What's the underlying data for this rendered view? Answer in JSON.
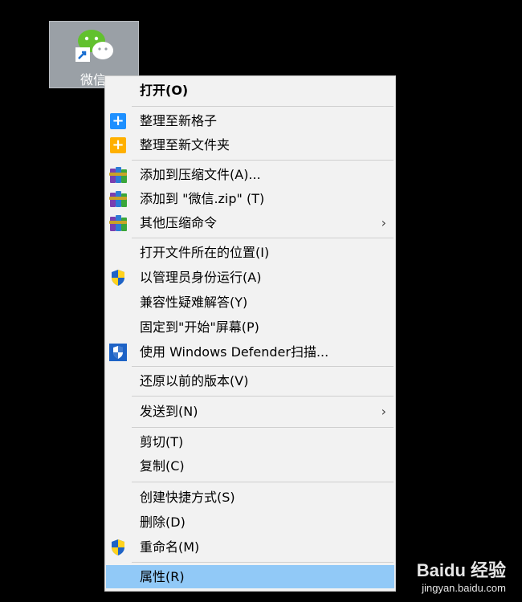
{
  "desktop": {
    "shortcut_label": "微信"
  },
  "menu": {
    "open": "打开(O)",
    "organize_new_box": "整理至新格子",
    "organize_new_folder": "整理至新文件夹",
    "add_to_archive": "添加到压缩文件(A)...",
    "add_to_zip": "添加到 \"微信.zip\" (T)",
    "other_compress": "其他压缩命令",
    "open_file_location": "打开文件所在的位置(I)",
    "run_as_admin": "以管理员身份运行(A)",
    "troubleshoot_compat": "兼容性疑难解答(Y)",
    "pin_to_start": "固定到\"开始\"屏幕(P)",
    "defender_scan": "使用 Windows Defender扫描...",
    "restore_previous": "还原以前的版本(V)",
    "send_to": "发送到(N)",
    "cut": "剪切(T)",
    "copy": "复制(C)",
    "create_shortcut": "创建快捷方式(S)",
    "delete": "删除(D)",
    "rename": "重命名(M)",
    "properties": "属性(R)",
    "submenu_arrow": "›"
  },
  "watermark": {
    "title": "Baidu 经验",
    "url": "jingyan.baidu.com"
  },
  "colors": {
    "selected": "#91c9f7",
    "menu_bg": "#f2f2f2",
    "desktop": "#000000"
  }
}
